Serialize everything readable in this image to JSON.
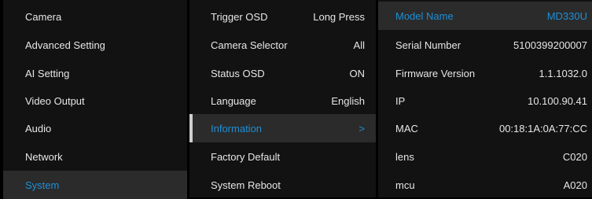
{
  "menu": [
    {
      "label": "Camera"
    },
    {
      "label": "Advanced Setting"
    },
    {
      "label": "AI Setting"
    },
    {
      "label": "Video Output"
    },
    {
      "label": "Audio"
    },
    {
      "label": "Network"
    },
    {
      "label": "System"
    }
  ],
  "submenu": [
    {
      "label": "Trigger OSD",
      "value": "Long Press"
    },
    {
      "label": "Camera Selector",
      "value": "All"
    },
    {
      "label": "Status OSD",
      "value": "ON"
    },
    {
      "label": "Language",
      "value": "English"
    },
    {
      "label": "Information",
      "value": ">"
    },
    {
      "label": "Factory Default",
      "value": ""
    },
    {
      "label": "System Reboot",
      "value": ""
    }
  ],
  "info": [
    {
      "label": "Model Name",
      "value": "MD330U"
    },
    {
      "label": "Serial Number",
      "value": "5100399200007"
    },
    {
      "label": "Firmware Version",
      "value": "1.1.1032.0"
    },
    {
      "label": "IP",
      "value": "10.100.90.41"
    },
    {
      "label": "MAC",
      "value": "00:18:1A:0A:77:CC"
    },
    {
      "label": "lens",
      "value": "C020"
    },
    {
      "label": "mcu",
      "value": "A020"
    }
  ],
  "colors": {
    "highlight": "#1e8fd6",
    "panel": "#121212",
    "selected": "#2b2b2b"
  }
}
